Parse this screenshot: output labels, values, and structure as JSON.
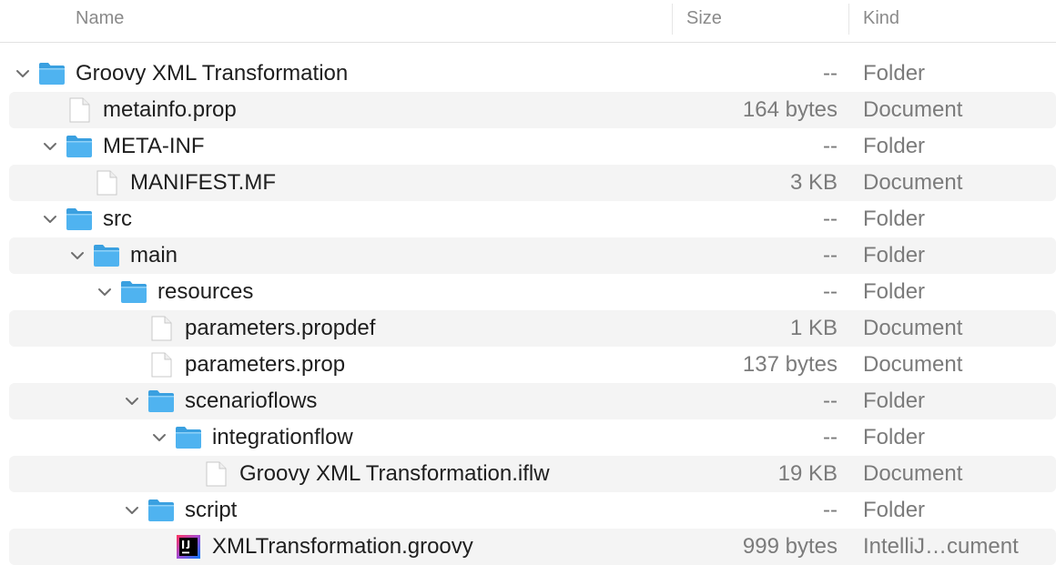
{
  "columns": {
    "name": "Name",
    "size": "Size",
    "kind": "Kind"
  },
  "rows": [
    {
      "name": "Groovy XML Transformation",
      "size": "--",
      "kind": "Folder",
      "type": "folder",
      "depth": 0,
      "expanded": true,
      "icon": "folder-icon"
    },
    {
      "name": "metainfo.prop",
      "size": "164 bytes",
      "kind": "Document",
      "type": "document",
      "depth": 1,
      "icon": "document-icon"
    },
    {
      "name": "META-INF",
      "size": "--",
      "kind": "Folder",
      "type": "folder",
      "depth": 1,
      "expanded": true,
      "icon": "folder-icon"
    },
    {
      "name": "MANIFEST.MF",
      "size": "3 KB",
      "kind": "Document",
      "type": "document",
      "depth": 2,
      "icon": "document-icon"
    },
    {
      "name": "src",
      "size": "--",
      "kind": "Folder",
      "type": "folder",
      "depth": 1,
      "expanded": true,
      "icon": "folder-icon"
    },
    {
      "name": "main",
      "size": "--",
      "kind": "Folder",
      "type": "folder",
      "depth": 2,
      "expanded": true,
      "icon": "folder-icon"
    },
    {
      "name": "resources",
      "size": "--",
      "kind": "Folder",
      "type": "folder",
      "depth": 3,
      "expanded": true,
      "icon": "folder-icon"
    },
    {
      "name": "parameters.propdef",
      "size": "1 KB",
      "kind": "Document",
      "type": "document",
      "depth": 4,
      "icon": "document-icon"
    },
    {
      "name": "parameters.prop",
      "size": "137 bytes",
      "kind": "Document",
      "type": "document",
      "depth": 4,
      "icon": "document-icon"
    },
    {
      "name": "scenarioflows",
      "size": "--",
      "kind": "Folder",
      "type": "folder",
      "depth": 4,
      "expanded": true,
      "icon": "folder-icon"
    },
    {
      "name": "integrationflow",
      "size": "--",
      "kind": "Folder",
      "type": "folder",
      "depth": 5,
      "expanded": true,
      "icon": "folder-icon"
    },
    {
      "name": "Groovy XML Transformation.iflw",
      "size": "19 KB",
      "kind": "Document",
      "type": "document",
      "depth": 6,
      "icon": "document-icon"
    },
    {
      "name": "script",
      "size": "--",
      "kind": "Folder",
      "type": "folder",
      "depth": 4,
      "expanded": true,
      "icon": "folder-icon"
    },
    {
      "name": "XMLTransformation.groovy",
      "size": "999 bytes",
      "kind": "IntelliJ…cument",
      "type": "intellij",
      "depth": 5,
      "icon": "intellij-idea-icon"
    }
  ],
  "colors": {
    "folder": "#4fb3f0",
    "folder_dark": "#3aa0e0",
    "stripe": "#f4f4f4",
    "secondary_text": "#7b7b7b"
  }
}
